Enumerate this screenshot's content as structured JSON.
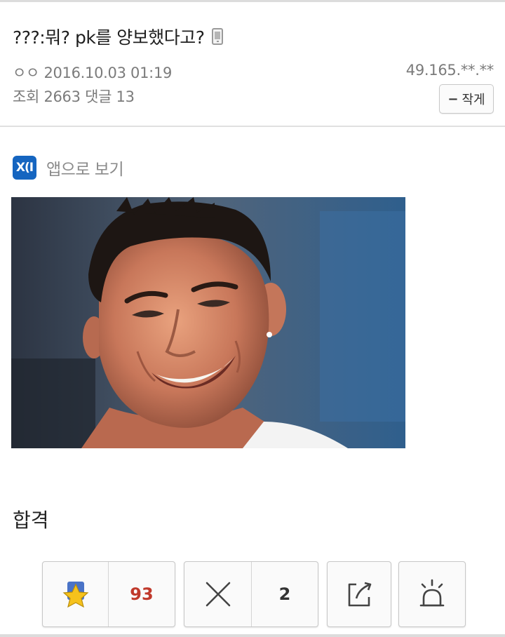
{
  "post": {
    "title": "???:뭐? pk를 양보했다고?",
    "author": "ㅇㅇ",
    "datetime": "2016.10.03 01:19",
    "ip": "49.165.**.**",
    "views_label": "조회",
    "views": "2663",
    "comments_label": "댓글",
    "comments": "13",
    "author_button_label": "작게",
    "app_view_label": "앱으로 보기",
    "app_logo_text": "X(I",
    "body_text": "합격"
  },
  "actions": {
    "recommend_count": "93",
    "not_recommend_count": "2",
    "recommend_icon": "star-icon",
    "not_recommend_icon": "x-icon",
    "share_icon": "share-icon",
    "report_icon": "siren-icon",
    "recommend_color": "#c0392b"
  },
  "colors": {
    "app_logo_bg": "#1565c0",
    "star_fill": "#f6c21c",
    "star_bg": "#4a73c7"
  }
}
